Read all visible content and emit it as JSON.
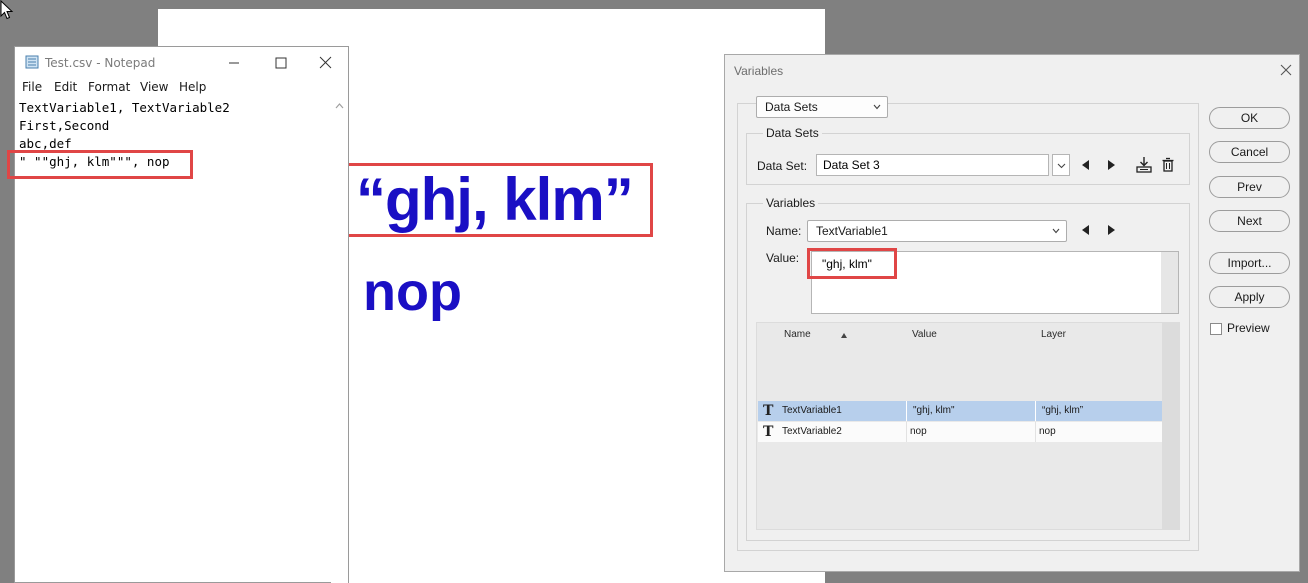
{
  "canvas": {
    "headline": "“ghj, klm”",
    "subline": "nop"
  },
  "notepad": {
    "title": "Test.csv - Notepad",
    "menu": [
      "File",
      "Edit",
      "Format",
      "View",
      "Help"
    ],
    "lines": [
      "TextVariable1, TextVariable2",
      "First,Second",
      "abc,def",
      "\" \"\"ghj, klm\"\"\", nop"
    ]
  },
  "variables_dialog": {
    "title": "Variables",
    "mode_dropdown": "Data Sets",
    "data_sets_group": "Data Sets",
    "data_set_label": "Data Set:",
    "data_set_value": "Data Set 3",
    "variables_group": "Variables",
    "name_label": "Name:",
    "name_value": "TextVariable1",
    "value_label": "Value:",
    "value_text": "\"ghj, klm\"",
    "table": {
      "headers": [
        "Name",
        "Value",
        "Layer"
      ],
      "rows": [
        {
          "name": "TextVariable1",
          "value": "\"ghj, klm\"",
          "layer": "“ghj, klm”",
          "selected": true
        },
        {
          "name": "TextVariable2",
          "value": "nop",
          "layer": "nop",
          "selected": false
        }
      ]
    },
    "buttons": {
      "ok": "OK",
      "cancel": "Cancel",
      "prev": "Prev",
      "next": "Next",
      "import": "Import...",
      "apply": "Apply"
    },
    "preview_label": "Preview",
    "preview_checked": false
  },
  "colors": {
    "canvas_text": "#1a0fc4",
    "highlight_box": "#e04646",
    "selected_row": "#b7cfec"
  }
}
